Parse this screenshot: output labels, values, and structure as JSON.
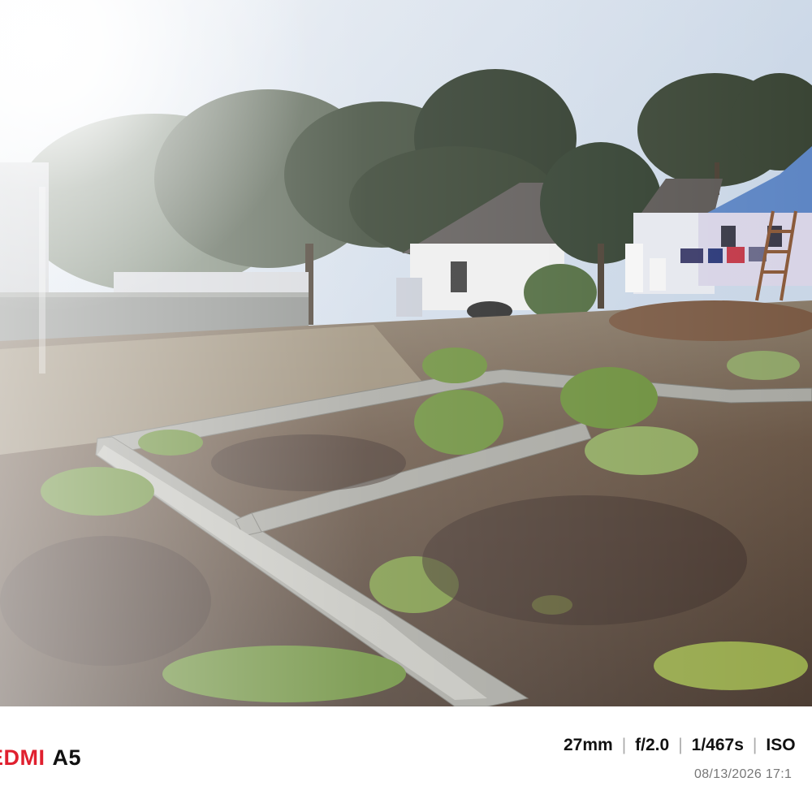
{
  "photo": {
    "description_name": "garden-plot-photo"
  },
  "watermark": {
    "brand_prefix": "EDMI",
    "brand_model": "A5",
    "brand_color": "#e0202f",
    "focal_length": "27mm",
    "aperture": "f/2.0",
    "shutter": "1/467s",
    "iso_label": "ISO",
    "datetime": "08/13/2026 17:1"
  }
}
